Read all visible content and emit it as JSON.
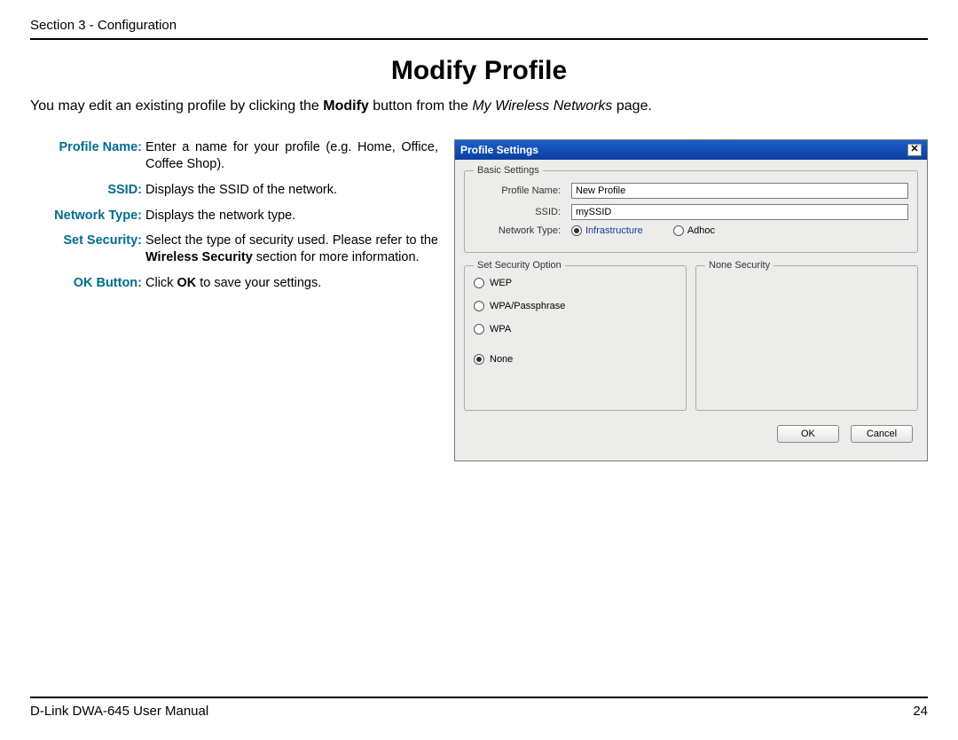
{
  "header": {
    "section": "Section 3 - Configuration"
  },
  "page_title": "Modify Profile",
  "intro": {
    "pre": "You may edit an existing profile by clicking the ",
    "bold": "Modify",
    "mid": " button from the ",
    "italic": "My Wireless Networks",
    "post": " page."
  },
  "definitions": [
    {
      "label": "Profile Name:",
      "desc_plain": "Enter a name for your profile (e.g. Home, Office, Coffee Shop)."
    },
    {
      "label": "SSID:",
      "desc_plain": "Displays the SSID of the network."
    },
    {
      "label": "Network Type:",
      "desc_plain": "Displays the network type."
    },
    {
      "label": "Set Security:",
      "desc_pre": "Select the type of security used. Please refer to the ",
      "desc_bold": "Wireless Security",
      "desc_post": " section for more information."
    },
    {
      "label": "OK Button:",
      "desc_pre": "Click ",
      "desc_bold": "OK",
      "desc_post": " to save your settings."
    }
  ],
  "dialog": {
    "title": "Profile Settings",
    "close_glyph": "✕",
    "basic_legend": "Basic Settings",
    "profile_name_label": "Profile Name:",
    "profile_name_value": "New Profile",
    "ssid_label": "SSID:",
    "ssid_value": "mySSID",
    "network_type_label": "Network Type:",
    "nt_infra": "Infrastructure",
    "nt_adhoc": "Adhoc",
    "security_legend": "Set Security Option",
    "none_legend": "None Security",
    "sec_options": {
      "wep": "WEP",
      "wpa_pass": "WPA/Passphrase",
      "wpa": "WPA",
      "none": "None"
    },
    "ok_label": "OK",
    "cancel_label": "Cancel"
  },
  "footer": {
    "manual": "D-Link DWA-645 User Manual",
    "page": "24"
  }
}
